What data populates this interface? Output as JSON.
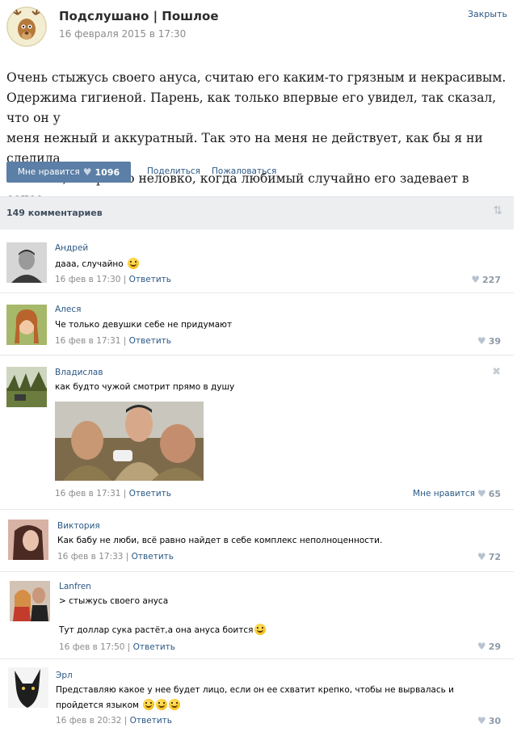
{
  "header": {
    "group_name": "Подслушано | Пошлое",
    "date": "16 февраля 2015 в 17:30",
    "close_label": "Закрыть"
  },
  "post": {
    "text_lines": [
      "Очень стыжусь своего ануса, считаю его каким-то грязным и некрасивым.",
      "Одержима гигиеной. Парень, как только впервые его увидел, так сказал, что он у",
      "меня нежный и аккуратный. Так это на меня не действует, как бы я ни следила",
      "за собой, все равно неловко, когда любимый случайно его задевает в сексе."
    ]
  },
  "actions": {
    "like_label": "Мне нравится",
    "like_count": "1096",
    "share_label": "Поделиться",
    "report_label": "Пожаловаться"
  },
  "comments_header": {
    "count_label": "149 комментариев"
  },
  "comments": [
    {
      "author": "Андрей",
      "text": "дааа, случайно",
      "date": "16 фев в 17:30",
      "reply": "Ответить",
      "likes": "227"
    },
    {
      "author": "Алеся",
      "text": "Че только девушки себе не придумают",
      "date": "16 фев в 17:31",
      "reply": "Ответить",
      "likes": "39"
    },
    {
      "author": "Владислав",
      "text": "как будто чужой смотрит прямо в душу",
      "date": "16 фев в 17:31",
      "reply": "Ответить",
      "like_label": "Мне нравится",
      "likes": "65"
    },
    {
      "author": "Виктория",
      "text": "Как бабу не люби, всё равно найдет в себе комплекс неполноценности.",
      "date": "16 фев в 17:33",
      "reply": "Ответить",
      "likes": "72"
    },
    {
      "author": "Lanfren",
      "text": "> стыжусь своего ануса",
      "text2": "Тут доллар сука растёт,а она ануса боится",
      "date": "16 фев в 17:50",
      "reply": "Ответить",
      "likes": "29"
    },
    {
      "author": "Эрл",
      "text": "Представляю какое у нее будет лицо, если он ее схватит крепко, чтобы не вырвалась и",
      "text2": "пройдется языком",
      "date": "16 фев в 20:32",
      "reply": "Ответить",
      "likes": "30"
    }
  ],
  "colors": {
    "link": "#2a5885",
    "like_button": "#5b7fa6",
    "bar": "#edeef0"
  }
}
